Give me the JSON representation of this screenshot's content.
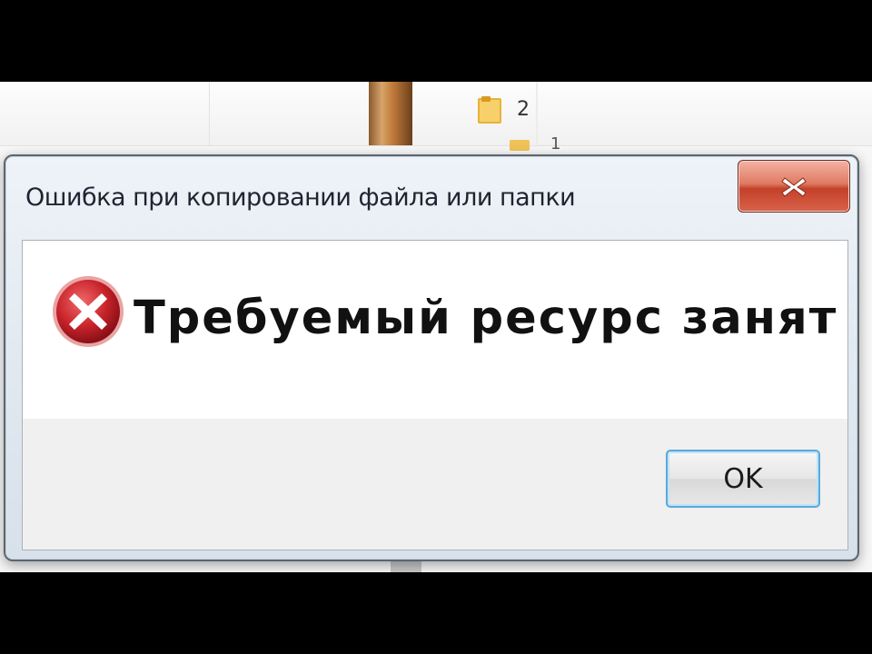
{
  "explorer": {
    "folder_count": "2",
    "folder_count_secondary": "1"
  },
  "dialog": {
    "title": "Ошибка при копировании файла или папки",
    "message": "Требуемый ресурс занят",
    "ok_label": "OK",
    "icons": {
      "error": "error-icon",
      "close": "close-icon",
      "folder": "folder-icon"
    },
    "colors": {
      "error_red": "#c8232b",
      "close_button_red": "#c4412a",
      "ok_focus_blue": "#5aa9dc",
      "title_bar": "#dfe7ef"
    }
  }
}
